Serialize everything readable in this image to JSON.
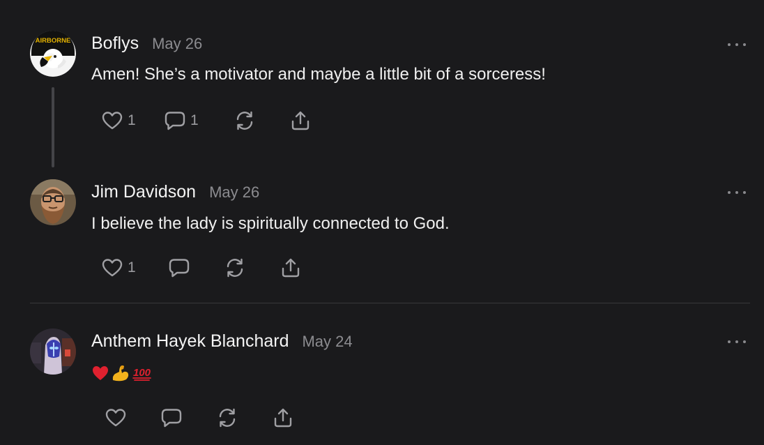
{
  "comments": [
    {
      "author": "Boflys",
      "date": "May 26",
      "text": "Amen! She’s a motivator and maybe a little bit of a sorceress!",
      "like_count": "1",
      "reply_count": "1",
      "avatar_text": "AIRBORNE"
    },
    {
      "author": "Jim Davidson",
      "date": "May 26",
      "text": "I believe the lady is spiritually connected to God.",
      "like_count": "1",
      "reply_count": ""
    },
    {
      "author": "Anthem Hayek Blanchard",
      "date": "May 24",
      "text": "",
      "like_count": "",
      "reply_count": "",
      "emojis": [
        "red-heart",
        "flexed-biceps",
        "hundred-points"
      ]
    }
  ],
  "icons": {
    "like": "heart-icon",
    "reply": "comment-bubble-icon",
    "restack": "restack-icon",
    "share": "share-upload-icon",
    "more": "more-dots-icon"
  },
  "colors": {
    "background": "#1a1a1c",
    "text": "#f2f2f2",
    "muted": "#8c8c90",
    "icon": "#a0a0a4",
    "divider": "#38383b"
  }
}
